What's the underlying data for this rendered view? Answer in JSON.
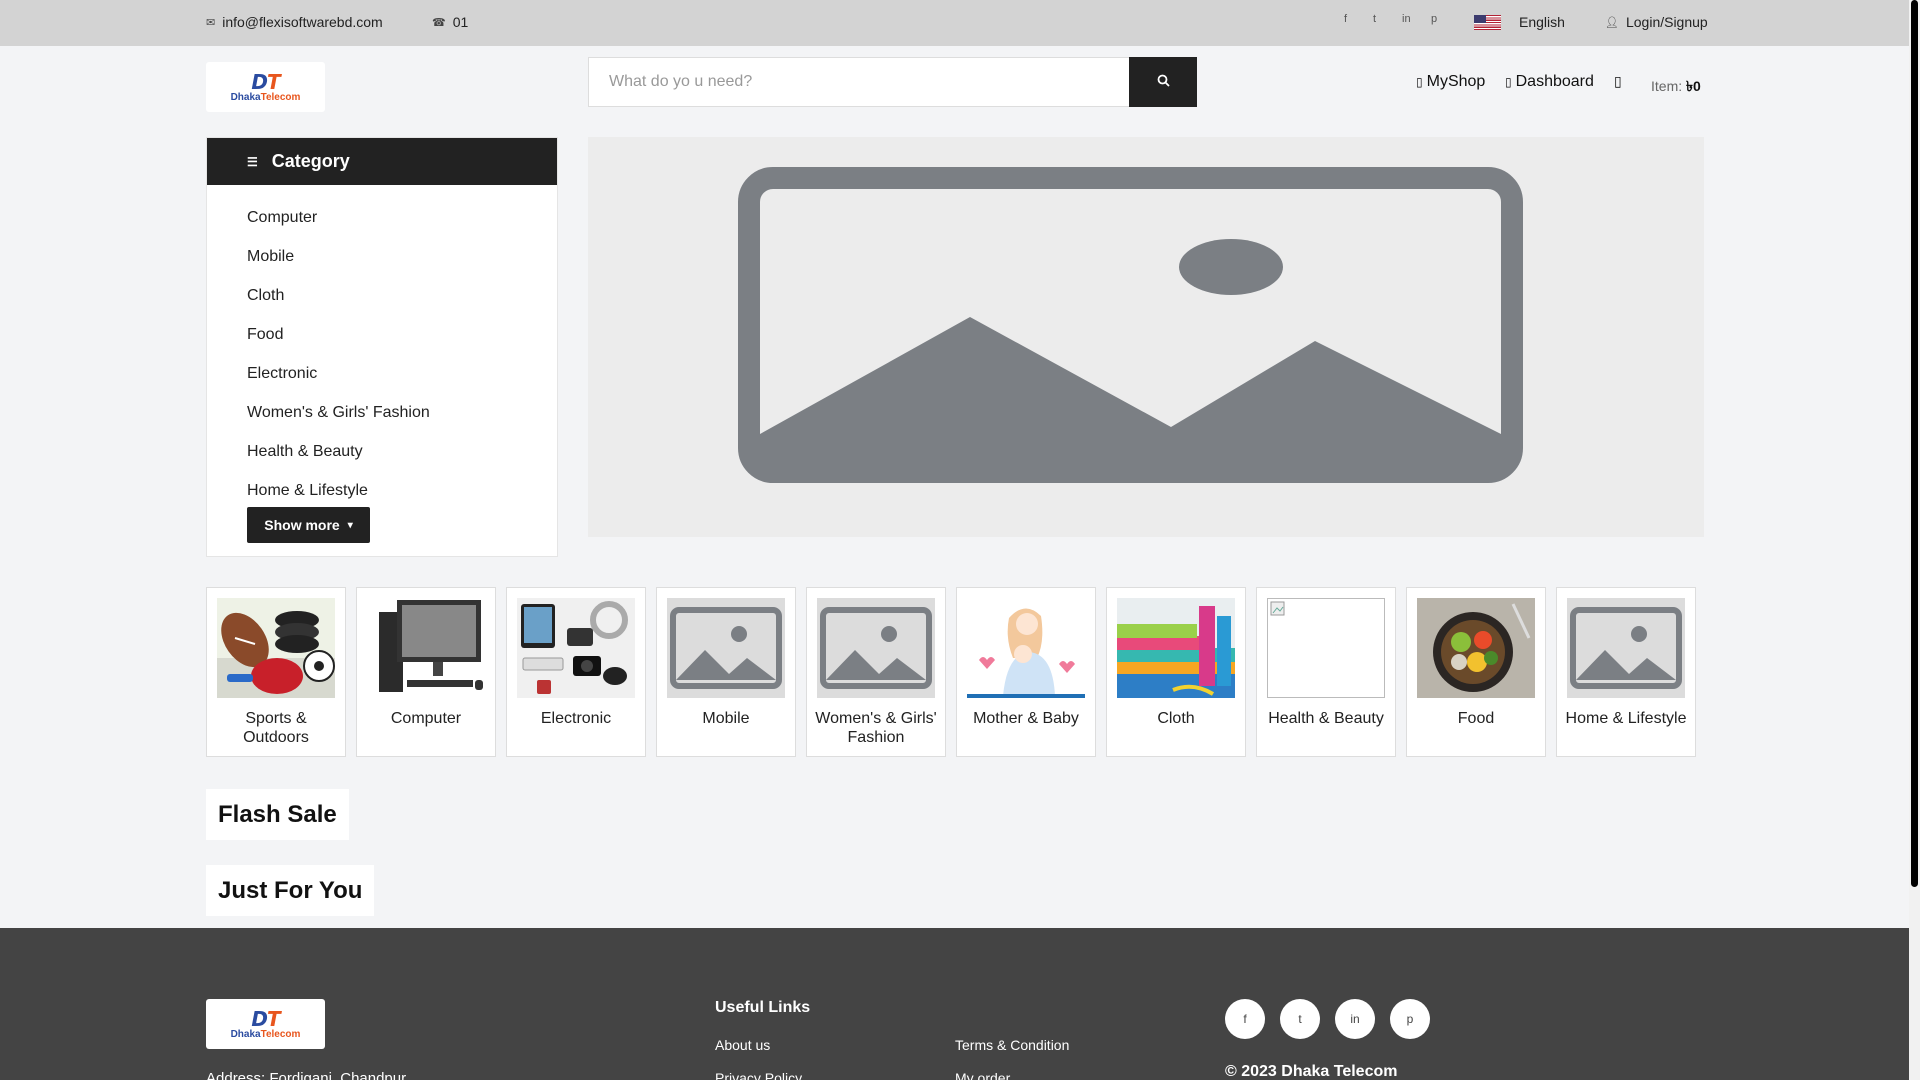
{
  "topbar": {
    "email": "info@flexisoftwarebd.com",
    "phone": "01",
    "language": "English",
    "login": "Login/Signup"
  },
  "header": {
    "logo_mark": "DT",
    "logo_text_a": "Dhaka",
    "logo_text_b": "Telecom",
    "search_placeholder": "What do yo u need?",
    "nav": {
      "myshop": "MyShop",
      "dashboard": "Dashboard"
    },
    "cart_label": "Item:",
    "cart_value": "৳0"
  },
  "category_panel": {
    "title": "Category",
    "items": [
      "Computer",
      "Mobile",
      "Cloth",
      "Food",
      "Electronic",
      "Women's & Girls' Fashion",
      "Health & Beauty",
      "Home & Lifestyle"
    ],
    "show_more": "Show more"
  },
  "category_cards": [
    {
      "name": "Sports & Outdoors",
      "image": "sports"
    },
    {
      "name": "Computer",
      "image": "computer"
    },
    {
      "name": "Electronic",
      "image": "electronic"
    },
    {
      "name": "Mobile",
      "image": "placeholder"
    },
    {
      "name": "Women's & Girls' Fashion",
      "image": "placeholder"
    },
    {
      "name": "Mother & Baby",
      "image": "mother"
    },
    {
      "name": "Cloth",
      "image": "cloth"
    },
    {
      "name": "Health & Beauty",
      "image": "broken"
    },
    {
      "name": "Food",
      "image": "food"
    },
    {
      "name": "Home & Lifestyle",
      "image": "placeholder"
    }
  ],
  "sections": {
    "flash_sale": "Flash Sale",
    "just_for_you": "Just For You"
  },
  "footer": {
    "address": "Address: Fordiganj, Chandpur",
    "useful_links_title": "Useful Links",
    "links": {
      "about": "About us",
      "terms": "Terms & Condition",
      "privacy": "Privacy Policy",
      "order": "My order"
    },
    "copyright": "© 2023 Dhaka Telecom"
  },
  "colors": {
    "topbar_bg": "#d3d3d3",
    "dark": "#222222",
    "footer_bg": "#444444",
    "logo_blue": "#2a4ba0",
    "logo_orange": "#e8561e"
  }
}
